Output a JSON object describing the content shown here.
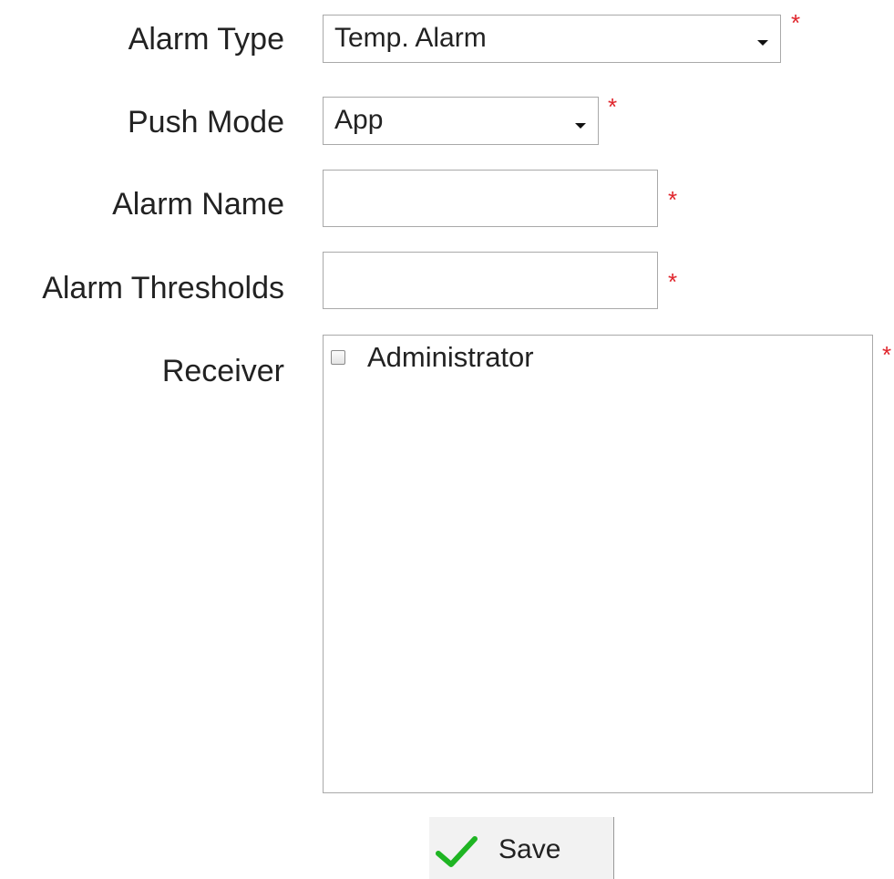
{
  "form": {
    "alarm_type": {
      "label": "Alarm Type",
      "value": "Temp. Alarm",
      "required_mark": "*"
    },
    "push_mode": {
      "label": "Push Mode",
      "value": "App",
      "required_mark": "*"
    },
    "alarm_name": {
      "label": "Alarm Name",
      "value": "",
      "required_mark": "*"
    },
    "alarm_thresholds": {
      "label": "Alarm Thresholds",
      "value": "",
      "required_mark": "*"
    },
    "receiver": {
      "label": "Receiver",
      "required_mark": "*",
      "options": [
        {
          "label": "Administrator",
          "checked": false
        }
      ]
    }
  },
  "actions": {
    "save_label": "Save",
    "save_icon": "checkmark-icon"
  },
  "colors": {
    "required": "#e0242b",
    "checkmark": "#1fb523",
    "border": "#a9a9a9",
    "button_bg": "#f2f2f2"
  }
}
